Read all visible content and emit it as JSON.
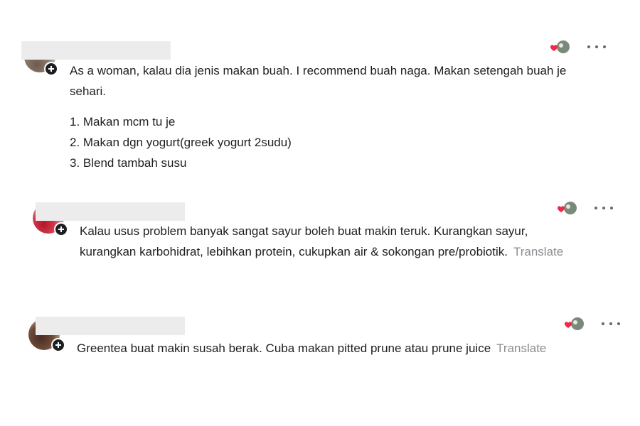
{
  "comments": [
    {
      "text": "As a woman, kalau dia jenis makan buah. I recommend buah naga. Makan setengah buah je sehari.",
      "list": [
        "1. Makan mcm tu je",
        "2. Makan dgn yogurt(greek yogurt 2sudu)",
        "3. Blend tambah susu"
      ],
      "translate": ""
    },
    {
      "text": "Kalau usus problem banyak sangat sayur boleh buat makin teruk. Kurangkan sayur, kurangkan karbohidrat, lebihkan protein, cukupkan air & sokongan pre/probiotik.",
      "translate": "Translate"
    },
    {
      "text": "Greentea buat makin susah berak. Cuba makan pitted prune atau prune juice",
      "translate": "Translate"
    }
  ],
  "colors": {
    "heart": "#f02849",
    "text": "#1c1e21",
    "muted": "#8a8d91",
    "redaction": "#ececec"
  },
  "icons": [
    "plus-icon",
    "heart-reaction-icon",
    "more-icon"
  ]
}
